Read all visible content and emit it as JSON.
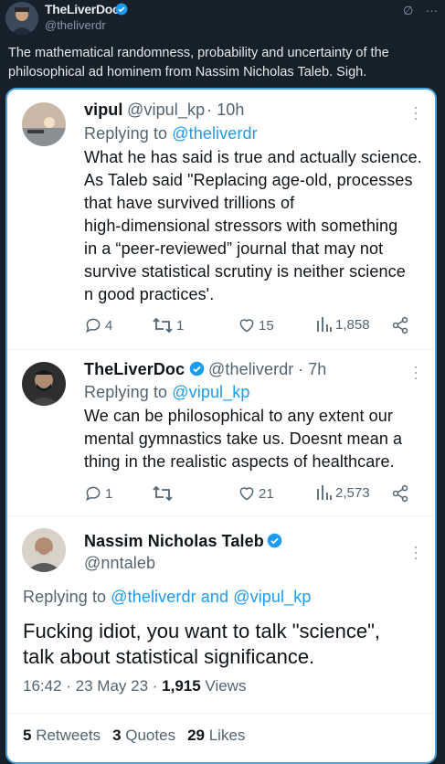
{
  "outer_tweet": {
    "name": "TheLiverDoc",
    "handle": "@theliverdr",
    "text": "The mathematical randomness, probability and uncertainty of the philosophical ad hominem from Nassim Nicholas Taleb. Sigh.",
    "actions": {
      "edit_glyph": "∅",
      "more_glyph": "···"
    }
  },
  "replies": [
    {
      "name": "vipul",
      "handle": "@vipul_kp",
      "time": "· 10h",
      "replying_prefix": "Replying to ",
      "replying_to": "@theliverdr",
      "lines": [
        "What he has said is true and actually science.",
        "As Taleb said \"Replacing age-old, processes",
        "that have survived trillions of",
        "high-dimensional stressors with something",
        "in a “peer-reviewed” journal that may not",
        "survive statistical scrutiny is neither science",
        "n good practices'."
      ],
      "replies_count": "4",
      "retweets_count": "1",
      "likes_count": "15",
      "views_count": "1,858"
    },
    {
      "name": "TheLiverDoc",
      "handle": "@theliverdr",
      "time": "· 7h",
      "replying_prefix": "Replying to ",
      "replying_to": "@vipul_kp",
      "lines": [
        "We can be philosophical to any extent our",
        "mental gymnastics take us. Doesnt mean a",
        "thing in the realistic aspects of healthcare."
      ],
      "replies_count": "1",
      "retweets_count": "",
      "likes_count": "21",
      "views_count": "2,573"
    }
  ],
  "main_tweet": {
    "name": "Nassim Nicholas Taleb",
    "handle": "@nntaleb",
    "replying_prefix": "Replying to ",
    "replying_to_1": "@theliverdr",
    "replying_and": " and ",
    "replying_to_2": "@vipul_kp",
    "lines": [
      "Fucking idiot, you want to talk \"science\",",
      "talk about statistical significance."
    ],
    "timestamp": "16:42 · 23 May 23 · ",
    "views_number": "1,915",
    "views_label": " Views",
    "retweets_number": "5",
    "retweets_label": " Retweets",
    "quotes_number": "3",
    "quotes_label": " Quotes",
    "likes_number": "29",
    "likes_label": " Likes"
  },
  "colors": {
    "background": "#15202b",
    "card": "#ffffff",
    "card_border": "#4aa0d8",
    "link": "#1d9bf0",
    "verified": "#1d9bf0",
    "muted": "#536471"
  }
}
